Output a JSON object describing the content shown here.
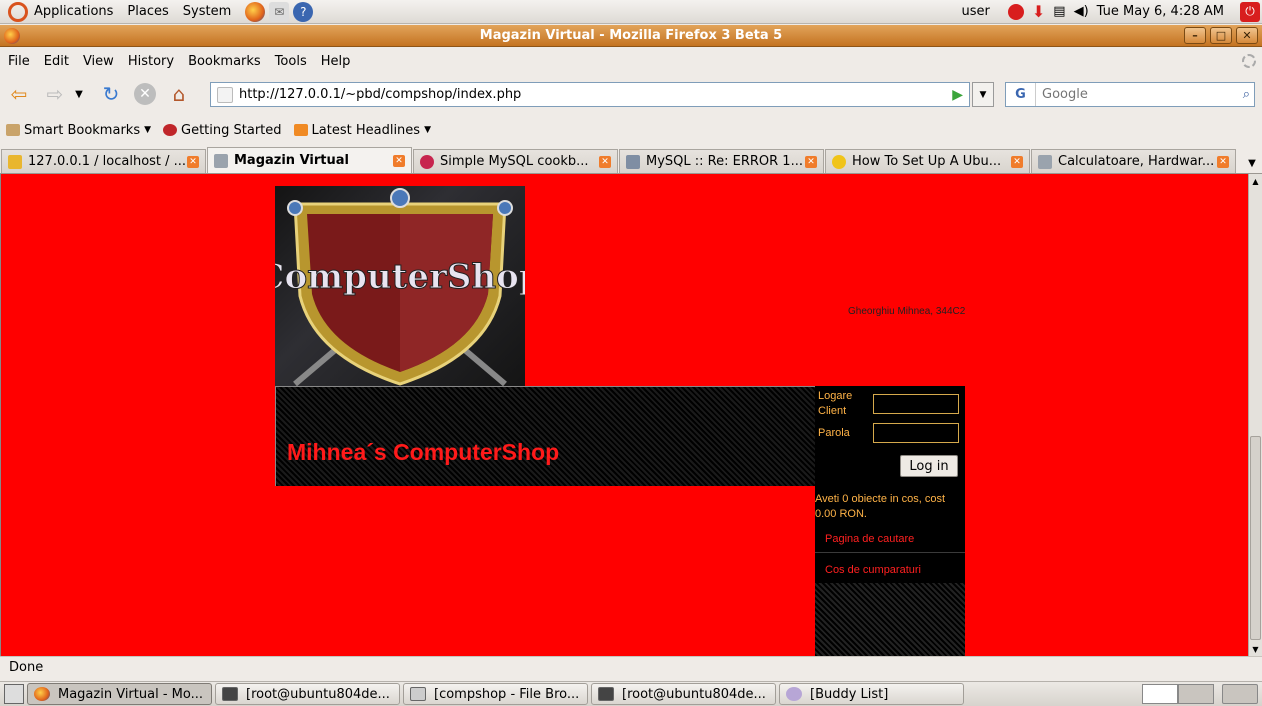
{
  "desktop_panel": {
    "menus": [
      "Applications",
      "Places",
      "System"
    ],
    "user": "user",
    "clock": "Tue May  6,  4:28 AM"
  },
  "window": {
    "title": "Magazin Virtual - Mozilla Firefox 3 Beta 5",
    "buttons": {
      "minimize": "–",
      "maximize": "□",
      "close": "✕"
    }
  },
  "menubar": {
    "items": [
      "File",
      "Edit",
      "View",
      "History",
      "Bookmarks",
      "Tools",
      "Help"
    ]
  },
  "navigation": {
    "url": "http://127.0.0.1/~pbd/compshop/index.php",
    "search_placeholder": "Google",
    "search_engine_letter": "G"
  },
  "bookmarks_toolbar": {
    "items": [
      "Smart Bookmarks",
      "Getting Started",
      "Latest Headlines"
    ]
  },
  "tabs": [
    {
      "label": "127.0.0.1 / localhost / ...",
      "icon_color": "#e9b62e",
      "active": false
    },
    {
      "label": "Magazin Virtual",
      "icon_color": "#9aa3ad",
      "active": true
    },
    {
      "label": "Simple MySQL cookb...",
      "icon_color": "#c7254e",
      "active": false
    },
    {
      "label": "MySQL :: Re: ERROR 1...",
      "icon_color": "#7f8ea3",
      "active": false
    },
    {
      "label": "How To Set Up A Ubu...",
      "icon_color": "#f0c419",
      "active": false
    },
    {
      "label": "Calculatoare, Hardwar...",
      "icon_color": "#9aa3ad",
      "active": false
    }
  ],
  "page": {
    "background": "#ff0000",
    "logo_text": "ComputerShop",
    "banner_title": "Mihnea´s ComputerShop",
    "author": "Gheorghiu Mihnea, 344C2",
    "login": {
      "client_label": "Logare Client",
      "password_label": "Parola",
      "button": "Log in"
    },
    "cart_text": "Aveti 0 obiecte in cos, cost 0.00 RON.",
    "links": [
      "Pagina de cautare",
      "Cos de cumparaturi"
    ]
  },
  "statusbar": {
    "text": "Done"
  },
  "taskbar": {
    "items": [
      {
        "label": "Magazin Virtual - Mo...",
        "active": true
      },
      {
        "label": "[root@ubuntu804de...",
        "active": false
      },
      {
        "label": "[compshop - File Bro...",
        "active": false
      },
      {
        "label": "[root@ubuntu804de...",
        "active": false
      },
      {
        "label": "[Buddy List]",
        "active": false
      }
    ]
  }
}
